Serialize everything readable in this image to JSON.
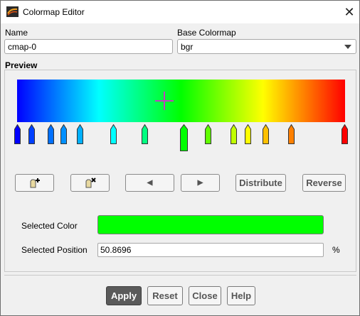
{
  "window": {
    "title": "Colormap Editor",
    "close_glyph": "✕"
  },
  "name_section": {
    "label": "Name",
    "value": "cmap-0"
  },
  "base_colormap": {
    "label": "Base Colormap",
    "value": "bgr"
  },
  "preview": {
    "label": "Preview",
    "gradient_colors": [
      "#0000ff",
      "#0080ff",
      "#00ffff",
      "#00ff80",
      "#00ff00",
      "#80ff00",
      "#ffff00",
      "#ff8000",
      "#ff0000"
    ],
    "crosshair_color": "#c040c0"
  },
  "markers": [
    {
      "color": "#0000ff",
      "position": 0,
      "selected": false
    },
    {
      "color": "#0040ff",
      "position": 4.5,
      "selected": false
    },
    {
      "color": "#0070ff",
      "position": 10.3,
      "selected": false
    },
    {
      "color": "#0090ff",
      "position": 14.1,
      "selected": false
    },
    {
      "color": "#00b0ff",
      "position": 19.3,
      "selected": false
    },
    {
      "color": "#00ffff",
      "position": 29.5,
      "selected": false
    },
    {
      "color": "#00ff80",
      "position": 39.0,
      "selected": false
    },
    {
      "color": "#00ff00",
      "position": 50.8696,
      "selected": true
    },
    {
      "color": "#60ff00",
      "position": 58.3,
      "selected": false
    },
    {
      "color": "#c0ff00",
      "position": 66.1,
      "selected": false
    },
    {
      "color": "#ffff00",
      "position": 70.4,
      "selected": false
    },
    {
      "color": "#ffc000",
      "position": 75.8,
      "selected": false
    },
    {
      "color": "#ff8000",
      "position": 83.6,
      "selected": false
    },
    {
      "color": "#ff0000",
      "position": 100,
      "selected": false
    }
  ],
  "toolbar": {
    "add_icon": "add-marker-icon",
    "delete_icon": "delete-marker-icon",
    "prev_glyph": "◀",
    "next_glyph": "▶",
    "distribute_label": "Distribute",
    "reverse_label": "Reverse"
  },
  "selected": {
    "color_label": "Selected Color",
    "color_value": "#00ff00",
    "position_label": "Selected Position",
    "position_value": "50.8696",
    "position_unit": "%"
  },
  "footer": {
    "apply_label": "Apply",
    "reset_label": "Reset",
    "close_label": "Close",
    "help_label": "Help"
  }
}
